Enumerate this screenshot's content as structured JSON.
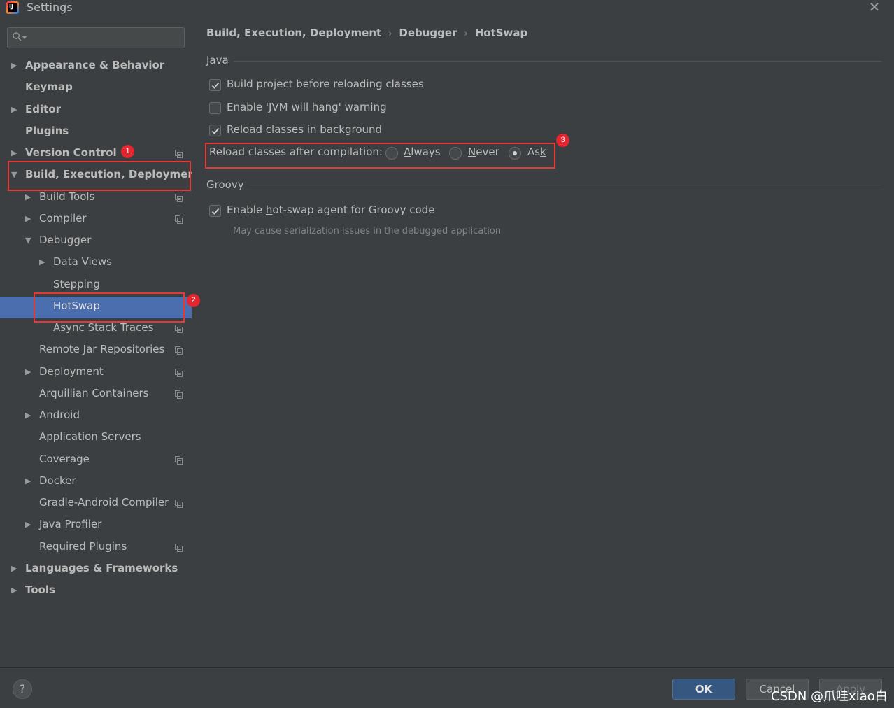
{
  "window": {
    "title": "Settings",
    "close_glyph": "✕"
  },
  "search": {
    "placeholder": "",
    "value": ""
  },
  "sidebar": {
    "items": [
      {
        "label": "Appearance & Behavior",
        "bold": true,
        "expandable": true,
        "expanded": false,
        "level": 0,
        "project_icon": false
      },
      {
        "label": "Keymap",
        "bold": true,
        "expandable": false,
        "level": 0,
        "project_icon": false
      },
      {
        "label": "Editor",
        "bold": true,
        "expandable": true,
        "expanded": false,
        "level": 0,
        "project_icon": false
      },
      {
        "label": "Plugins",
        "bold": true,
        "expandable": false,
        "level": 0,
        "project_icon": false
      },
      {
        "label": "Version Control",
        "bold": true,
        "expandable": true,
        "expanded": false,
        "level": 0,
        "project_icon": true
      },
      {
        "label": "Build, Execution, Deployment",
        "bold": true,
        "expandable": true,
        "expanded": true,
        "level": 0,
        "project_icon": false
      },
      {
        "label": "Build Tools",
        "bold": false,
        "expandable": true,
        "expanded": false,
        "level": 1,
        "project_icon": true
      },
      {
        "label": "Compiler",
        "bold": false,
        "expandable": true,
        "expanded": false,
        "level": 1,
        "project_icon": true
      },
      {
        "label": "Debugger",
        "bold": false,
        "expandable": true,
        "expanded": true,
        "level": 1,
        "project_icon": false
      },
      {
        "label": "Data Views",
        "bold": false,
        "expandable": true,
        "expanded": false,
        "level": 2,
        "project_icon": false
      },
      {
        "label": "Stepping",
        "bold": false,
        "expandable": false,
        "level": 2,
        "project_icon": false
      },
      {
        "label": "HotSwap",
        "bold": false,
        "expandable": false,
        "level": 2,
        "project_icon": false,
        "selected": true
      },
      {
        "label": "Async Stack Traces",
        "bold": false,
        "expandable": false,
        "level": 2,
        "project_icon": true
      },
      {
        "label": "Remote Jar Repositories",
        "bold": false,
        "expandable": false,
        "level": 1,
        "project_icon": true
      },
      {
        "label": "Deployment",
        "bold": false,
        "expandable": true,
        "expanded": false,
        "level": 1,
        "project_icon": true
      },
      {
        "label": "Arquillian Containers",
        "bold": false,
        "expandable": false,
        "level": 1,
        "project_icon": true
      },
      {
        "label": "Android",
        "bold": false,
        "expandable": true,
        "expanded": false,
        "level": 1,
        "project_icon": false
      },
      {
        "label": "Application Servers",
        "bold": false,
        "expandable": false,
        "level": 1,
        "project_icon": false
      },
      {
        "label": "Coverage",
        "bold": false,
        "expandable": false,
        "level": 1,
        "project_icon": true
      },
      {
        "label": "Docker",
        "bold": false,
        "expandable": true,
        "expanded": false,
        "level": 1,
        "project_icon": false
      },
      {
        "label": "Gradle-Android Compiler",
        "bold": false,
        "expandable": false,
        "level": 1,
        "project_icon": true
      },
      {
        "label": "Java Profiler",
        "bold": false,
        "expandable": true,
        "expanded": false,
        "level": 1,
        "project_icon": false
      },
      {
        "label": "Required Plugins",
        "bold": false,
        "expandable": false,
        "level": 1,
        "project_icon": true
      },
      {
        "label": "Languages & Frameworks",
        "bold": true,
        "expandable": true,
        "expanded": false,
        "level": 0,
        "project_icon": false
      },
      {
        "label": "Tools",
        "bold": true,
        "expandable": true,
        "expanded": false,
        "level": 0,
        "project_icon": false
      }
    ]
  },
  "breadcrumb": {
    "items": [
      "Build, Execution, Deployment",
      "Debugger",
      "HotSwap"
    ],
    "separator": "›"
  },
  "java_group": {
    "title": "Java",
    "build_before_reload": {
      "label": "Build project before reloading classes",
      "checked": true
    },
    "jvm_hang_warning": {
      "label": "Enable 'JVM will hang' warning",
      "checked": false
    },
    "reload_in_background": {
      "label_pre": "Reload classes in ",
      "label_mnemonic": "b",
      "label_post": "ackground",
      "checked": true
    },
    "reload_after_compilation": {
      "label": "Reload classes after compilation:",
      "options": [
        {
          "mnemonic": "A",
          "rest": "lways",
          "selected": false
        },
        {
          "mnemonic": "N",
          "rest": "ever",
          "selected": false
        },
        {
          "pre": "As",
          "mnemonic": "k",
          "rest": "",
          "selected": true
        }
      ]
    }
  },
  "groovy_group": {
    "title": "Groovy",
    "hotswap_agent": {
      "label_pre": "Enable ",
      "label_mnemonic": "h",
      "label_post": "ot-swap agent for Groovy code",
      "checked": true
    },
    "hint": "May cause serialization issues in the debugged application"
  },
  "annotations": {
    "badge_1": "1",
    "badge_2": "2",
    "badge_3": "3",
    "color": "#e53935"
  },
  "footer": {
    "help_label": "?",
    "ok_label": "OK",
    "cancel_label": "Cancel",
    "apply_label": "Apply",
    "watermark": "CSDN @爪哇xiao白"
  },
  "colors": {
    "background": "#3c3f41",
    "selection": "#4b6eaf",
    "ok_button": "#365880",
    "text": "#bbbbbb"
  }
}
